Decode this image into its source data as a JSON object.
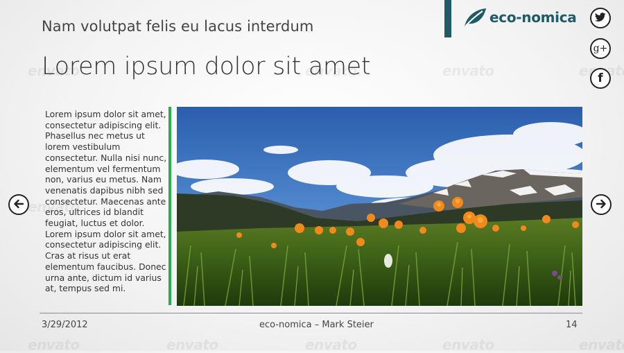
{
  "header": {
    "subtitle": "Nam volutpat felis eu lacus interdum",
    "title": "Lorem ipsum dolor sit amet"
  },
  "brand": {
    "name": "eco-nomica",
    "color": "#1f5a66"
  },
  "social": {
    "items": [
      {
        "name": "twitter",
        "icon": "twitter-icon"
      },
      {
        "name": "google-plus",
        "icon": "google-plus-icon",
        "label": "g+"
      },
      {
        "name": "facebook",
        "icon": "facebook-icon",
        "label": "f"
      }
    ]
  },
  "navigation": {
    "prev_icon": "arrow-left-icon",
    "next_icon": "arrow-right-icon"
  },
  "content": {
    "body": "Lorem ipsum dolor sit amet, consectetur adipiscing elit. Phasellus nec metus ut lorem vestibulum consectetur. Nulla nisi nunc, elementum vel fermentum non, varius eu metus. Nam venenatis dapibus nibh sed consectetur. Maecenas ante eros, ultrices id blandit feugiat, luctus et dolor. Lorem ipsum dolor sit amet, consectetur adipiscing elit. Cras at risus ut erat elementum faucibus. Donec urna ante, dictum id varius at, tempus sed mi.",
    "accent_color": "#22b14c"
  },
  "footer": {
    "date": "3/29/2012",
    "center": "eco-nomica – Mark Steier",
    "page": "14"
  },
  "watermark": {
    "text": "envato"
  }
}
